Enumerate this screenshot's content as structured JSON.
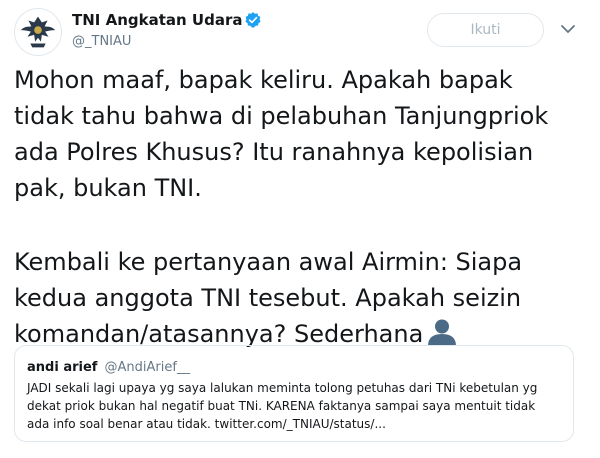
{
  "author": {
    "name": "TNI Angkatan Udara",
    "handle": "@_TNIAU"
  },
  "follow_button": "Ikuti",
  "tweet": {
    "paragraph1": [
      "Mohon maaf, bapak keliru. Apakah bapak",
      "tidak tahu bahwa di pelabuhan Tanjungpriok",
      "ada Polres Khusus? Itu ranahnya kepolisian",
      "pak, bukan TNI."
    ],
    "paragraph2": [
      "Kembali ke pertanyaan awal Airmin: Siapa",
      "kedua anggota TNI tesebut. Apakah seizin",
      "komandan/atasannya? Sederhana"
    ],
    "emoji": "bust-in-silhouette"
  },
  "quoted_tweet": {
    "name": "andi arief",
    "handle": "@AndiArief__",
    "lines": [
      "JADI sekali lagi upaya yg saya lalukan meminta tolong petuhas dari TNi kebetulan yg",
      "dekat priok bukan hal negatif buat TNi. KARENA faktanya sampai saya mentuit tidak",
      "ada info soal benar atau tidak. twitter.com/_TNIAU/status/..."
    ]
  },
  "colors": {
    "text": "#14171a",
    "secondary": "#657786",
    "border": "#e1e8ed",
    "verified": "#1da1f2",
    "button_text": "#aab8c2"
  }
}
